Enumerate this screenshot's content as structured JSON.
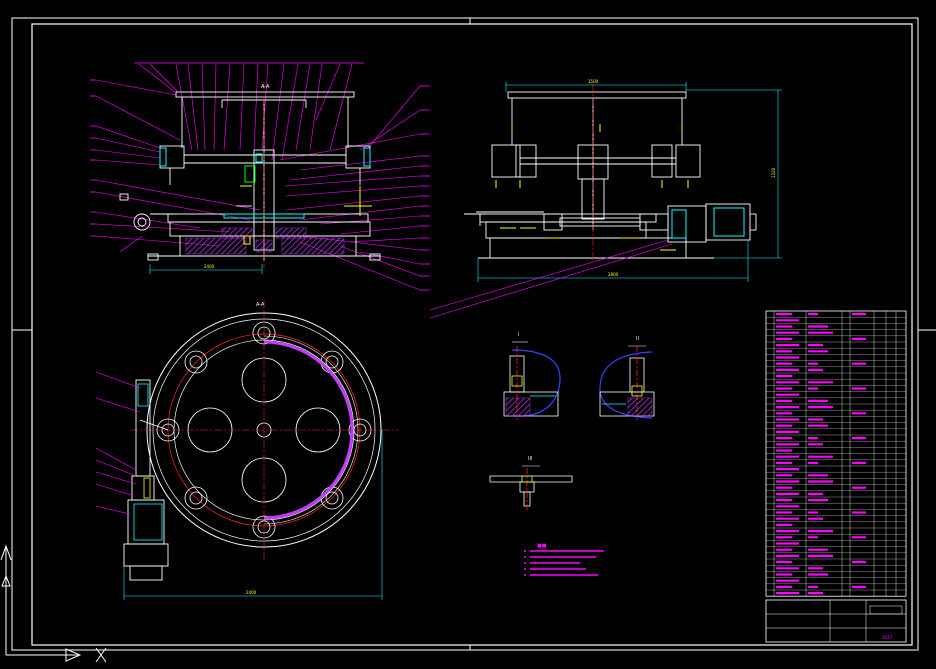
{
  "colors": {
    "background": "#000000",
    "frame": "#ffffff",
    "leader": "#ff00ff",
    "centerline": "#ff2020",
    "dimension": "#00ffff",
    "body": "#ffffff",
    "hatch": "#c23bff",
    "yellow": "#ffff00",
    "green": "#00ff00",
    "blue": "#3344ff"
  },
  "section_labels": {
    "top_left": "A-A",
    "bottom_left": "A-A",
    "detail1": "I",
    "detail2": "II",
    "detail3": "III"
  },
  "dimensions": {
    "front_width": "2400",
    "side_top": "1500",
    "side_height": "1320",
    "side_width": "2800",
    "plan_width": "2400"
  },
  "title_block": {
    "drawing_label": "2017"
  },
  "icons": {
    "ucs_arrow": "ucs-arrow-icon",
    "ucs_cross": "ucs-x-icon"
  }
}
